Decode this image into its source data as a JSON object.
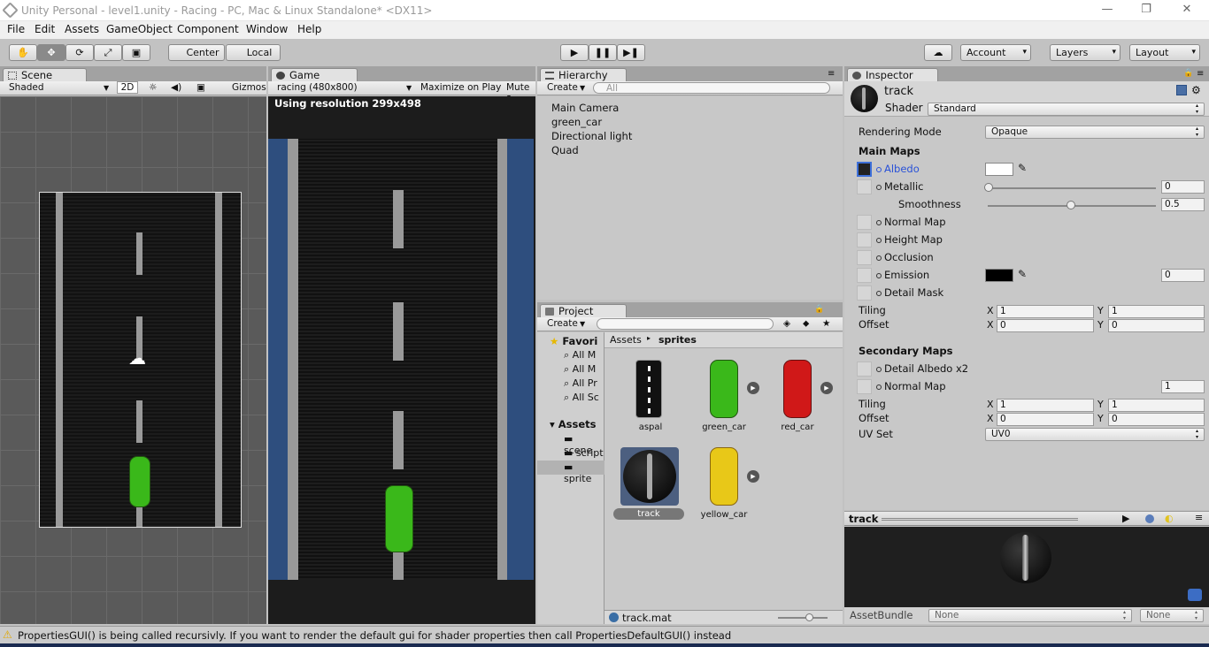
{
  "window": {
    "title": "Unity Personal - level1.unity - Racing - PC, Mac & Linux Standalone* <DX11>",
    "minimize": "—",
    "restore": "❐",
    "close": "✕"
  },
  "menu": [
    "File",
    "Edit",
    "Assets",
    "GameObject",
    "Component",
    "Window",
    "Help"
  ],
  "toolbar": {
    "pivot": "Center",
    "space": "Local",
    "account": "Account",
    "layers": "Layers",
    "layout": "Layout"
  },
  "scene": {
    "tab": "Scene",
    "shading": "Shaded",
    "mode_2d": "2D",
    "gizmos": "Gizmos"
  },
  "game": {
    "tab": "Game",
    "aspect": "racing (480x800)",
    "maximize": "Maximize on Play",
    "mute": "Mute a",
    "resolution_note": "Using resolution 299x498"
  },
  "hierarchy": {
    "tab": "Hierarchy",
    "create": "Create",
    "search_placeholder": "All",
    "items": [
      "Main Camera",
      "green_car",
      "Directional light",
      "Quad"
    ]
  },
  "project": {
    "tab": "Project",
    "create": "Create",
    "favorites_label": "Favori",
    "favorites": [
      "All M",
      "All M",
      "All Pr",
      "All Sc"
    ],
    "assets_label": "Assets",
    "folders": [
      "scene",
      "script",
      "sprite"
    ],
    "breadcrumb": [
      "Assets",
      "sprites"
    ],
    "assets": [
      "aspal",
      "green_car",
      "red_car",
      "track",
      "yellow_car"
    ],
    "selected_file": "track.mat"
  },
  "inspector": {
    "tab": "Inspector",
    "name": "track",
    "shader_label": "Shader",
    "shader": "Standard",
    "rendering_mode_label": "Rendering Mode",
    "rendering_mode": "Opaque",
    "main_maps": "Main Maps",
    "albedo": "Albedo",
    "metallic": "Metallic",
    "metallic_value": "0",
    "smoothness": "Smoothness",
    "smoothness_value": "0.5",
    "normal_map": "Normal Map",
    "height_map": "Height Map",
    "occlusion": "Occlusion",
    "emission": "Emission",
    "emission_value": "0",
    "detail_mask": "Detail Mask",
    "tiling": "Tiling",
    "offset": "Offset",
    "x": "X",
    "y": "Y",
    "main_tiling": [
      "1",
      "1"
    ],
    "main_offset": [
      "0",
      "0"
    ],
    "secondary_maps": "Secondary Maps",
    "detail_albedo": "Detail Albedo x2",
    "normal_map2": "Normal Map",
    "normal_map2_value": "1",
    "sec_tiling": [
      "1",
      "1"
    ],
    "sec_offset": [
      "0",
      "0"
    ],
    "uv_set_label": "UV Set",
    "uv_set": "UV0"
  },
  "preview": {
    "title": "track",
    "assetbundle_label": "AssetBundle",
    "bundle": "None",
    "variant": "None"
  },
  "status": {
    "message": "PropertiesGUI() is being called recursivly. If you want to render the default gui for shader properties then call PropertiesDefaultGUI() instead"
  },
  "colors": {
    "road": "#181818",
    "road_border_blue": "#2e4e7e",
    "car_green": "#3ab81a",
    "car_red": "#d01818",
    "car_yellow": "#e8c818",
    "panel": "#c8c8c8"
  }
}
